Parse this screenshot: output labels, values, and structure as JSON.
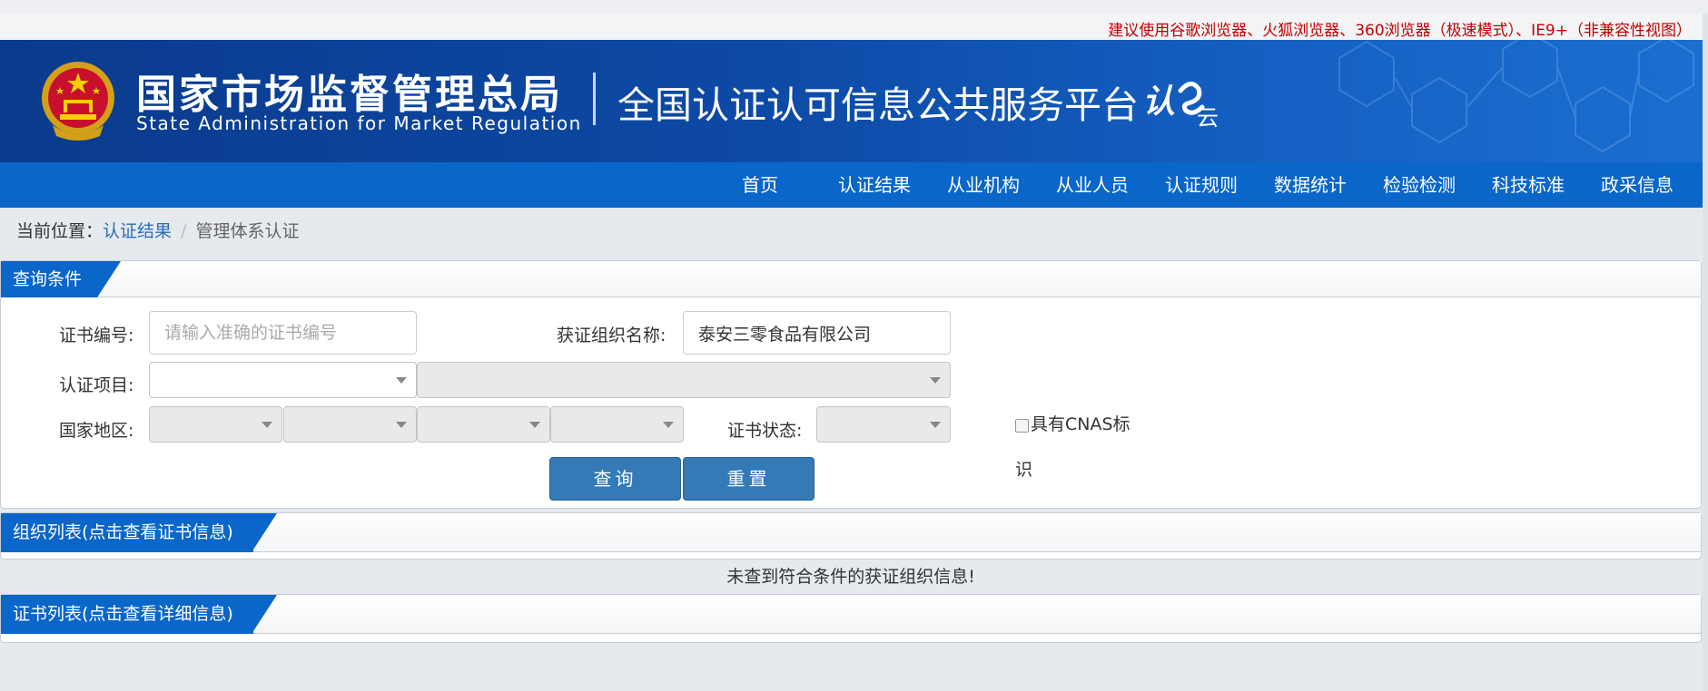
{
  "notice": "建议使用谷歌浏览器、火狐浏览器、360浏览器（极速模式）、IE9+（非兼容性视图）",
  "header": {
    "org_cn": "国家市场监督管理总局",
    "org_en": "State Administration  for  Market Regulation",
    "platform": "全国认证认可信息公共服务平台",
    "logo_text": "认e云"
  },
  "nav": {
    "items": [
      "首页",
      "认证结果",
      "从业机构",
      "从业人员",
      "认证规则",
      "数据统计",
      "检验检测",
      "科技标准",
      "政采信息"
    ]
  },
  "breadcrumb": {
    "label": "当前位置：",
    "link": "认证结果",
    "separator": "/",
    "current": "管理体系认证"
  },
  "query": {
    "title": "查询条件",
    "cert_no_label": "证书编号:",
    "cert_no_placeholder": "请输入准确的证书编号",
    "org_name_label": "获证组织名称:",
    "org_name_value": "泰安三零食品有限公司",
    "project_label": "认证项目:",
    "region_label": "国家地区:",
    "status_label": "证书状态:",
    "cnas_label": "具有CNAS标识",
    "search_button": "查询",
    "reset_button": "重置"
  },
  "org_list": {
    "title": "组织列表(点击查看证书信息)",
    "empty_message": "未查到符合条件的获证组织信息!"
  },
  "cert_list": {
    "title": "证书列表(点击查看详细信息)"
  },
  "colors": {
    "nav_blue": "#0a66c8",
    "banner_blue": "#0d4aa6",
    "button_blue": "#337ab7",
    "notice_red": "#c00000",
    "link_blue": "#2a6fba"
  }
}
